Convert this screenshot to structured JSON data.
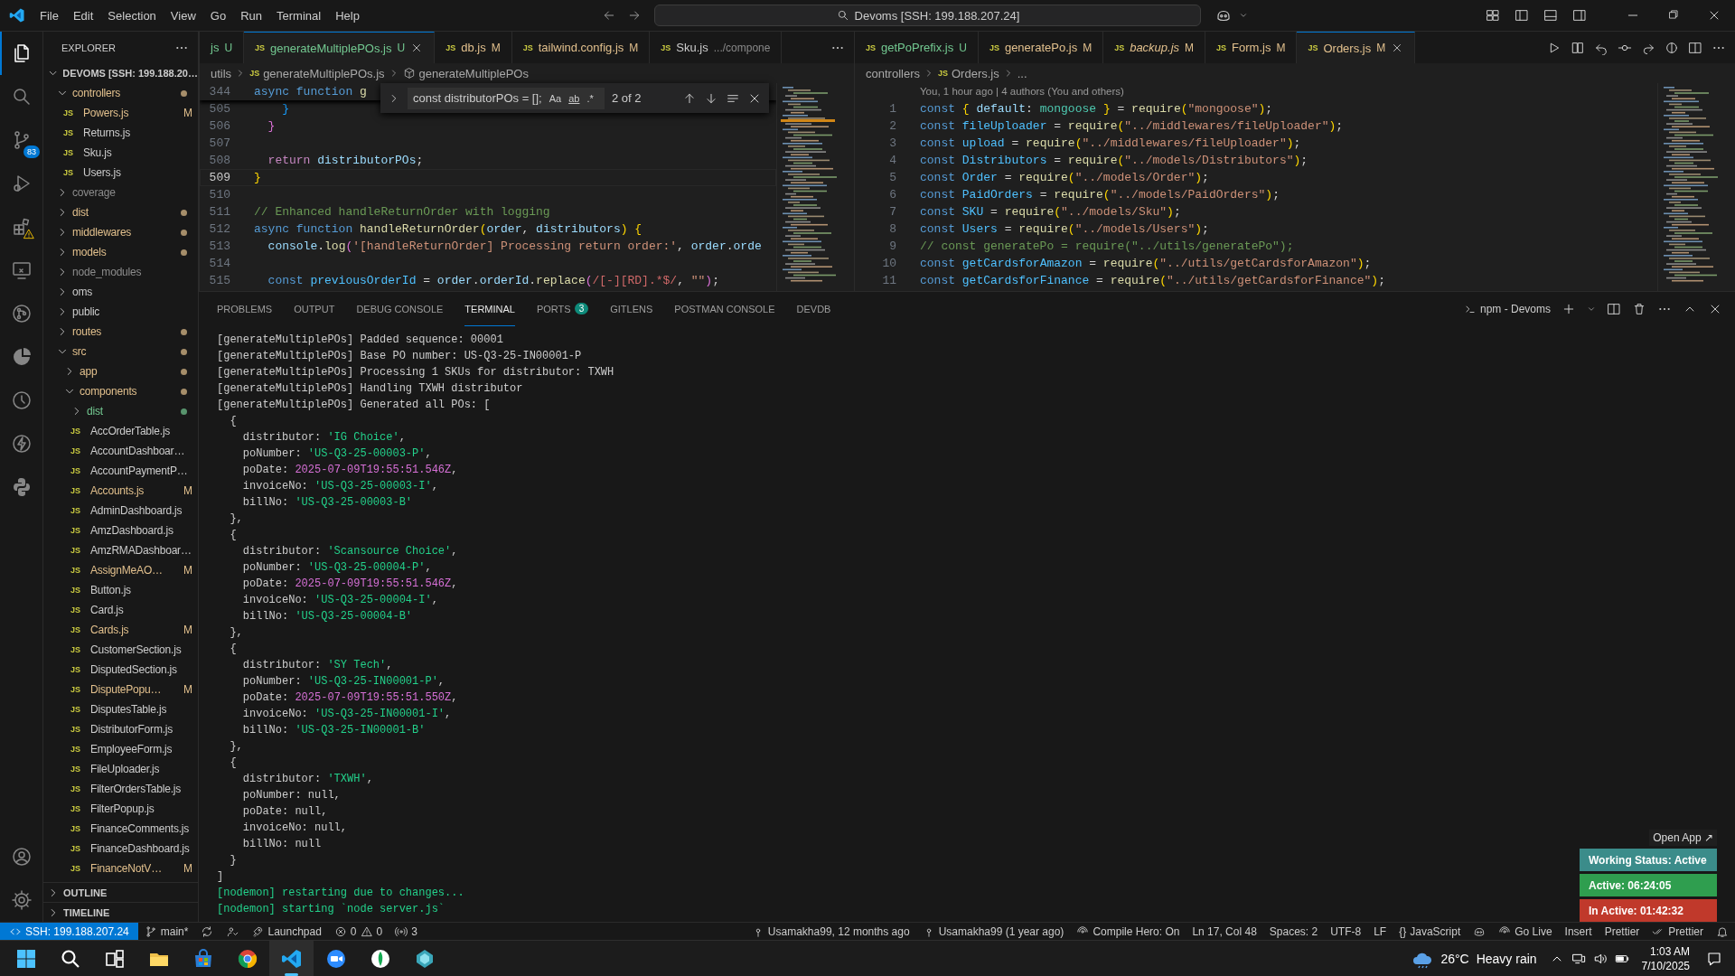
{
  "titlebar": {
    "menu": [
      "File",
      "Edit",
      "Selection",
      "View",
      "Go",
      "Run",
      "Terminal",
      "Help"
    ],
    "command_center": "Devoms [SSH: 199.188.207.24]"
  },
  "activity_bar": [
    {
      "kind": "files",
      "selected": true
    },
    {
      "kind": "search",
      "selected": false
    },
    {
      "kind": "source-control",
      "selected": false,
      "badge": "83"
    },
    {
      "kind": "debug",
      "selected": false
    },
    {
      "kind": "extensions",
      "selected": false,
      "warning": true
    },
    {
      "kind": "remote",
      "selected": false
    },
    {
      "kind": "git-graph",
      "selected": false
    },
    {
      "kind": "pie",
      "selected": false
    },
    {
      "kind": "history",
      "selected": false
    },
    {
      "kind": "bolt",
      "selected": false
    },
    {
      "kind": "python",
      "selected": false
    }
  ],
  "activity_bottom": [
    {
      "kind": "account"
    },
    {
      "kind": "settings"
    }
  ],
  "explorer": {
    "title": "EXPLORER",
    "root": "DEVOMS [SSH: 199.188.20…",
    "tree": [
      {
        "name": "controllers",
        "kind": "folder",
        "expanded": true,
        "color": "#e2c08d",
        "dot": true,
        "children": [
          {
            "name": "Powers.js",
            "kind": "file",
            "icon": "JS",
            "color": "#e2c08d",
            "dot": false,
            "badge": "M"
          },
          {
            "name": "Returns.js",
            "kind": "file",
            "icon": "JS",
            "color": "#cccccc",
            "dot": false
          },
          {
            "name": "Sku.js",
            "kind": "file",
            "icon": "JS",
            "color": "#cccccc",
            "dot": false
          },
          {
            "name": "Users.js",
            "kind": "file",
            "icon": "JS",
            "color": "#cccccc",
            "dot": false
          }
        ]
      },
      {
        "name": "coverage",
        "kind": "folder",
        "expanded": false,
        "color": "#8c8c8c",
        "dot": false
      },
      {
        "name": "dist",
        "kind": "folder",
        "expanded": false,
        "color": "#e2c08d",
        "dot": true
      },
      {
        "name": "middlewares",
        "kind": "folder",
        "expanded": false,
        "color": "#e2c08d",
        "dot": true
      },
      {
        "name": "models",
        "kind": "folder",
        "expanded": false,
        "color": "#e2c08d",
        "dot": true
      },
      {
        "name": "node_modules",
        "kind": "folder",
        "expanded": false,
        "color": "#8c8c8c",
        "dot": false
      },
      {
        "name": "oms",
        "kind": "folder",
        "expanded": false,
        "color": "#cccccc",
        "dot": false
      },
      {
        "name": "public",
        "kind": "folder",
        "expanded": false,
        "color": "#cccccc",
        "dot": false
      },
      {
        "name": "routes",
        "kind": "folder",
        "expanded": false,
        "color": "#e2c08d",
        "dot": true
      },
      {
        "name": "src",
        "kind": "folder",
        "expanded": true,
        "color": "#e2c08d",
        "dot": true,
        "children": [
          {
            "name": "app",
            "kind": "folder",
            "expanded": false,
            "color": "#e2c08d",
            "dot": true
          },
          {
            "name": "components",
            "kind": "folder",
            "expanded": true,
            "color": "#e2c08d",
            "dot": true,
            "children": [
              {
                "name": "dist",
                "kind": "folder",
                "expanded": false,
                "color": "#73c991",
                "dot": true
              },
              {
                "name": "AccOrderTable.js",
                "kind": "file",
                "icon": "JS",
                "color": "#cccccc",
                "dot": false
              },
              {
                "name": "AccountDashboar…",
                "kind": "file",
                "icon": "JS",
                "color": "#cccccc",
                "dot": false
              },
              {
                "name": "AccountPaymentP…",
                "kind": "file",
                "icon": "JS",
                "color": "#cccccc",
                "dot": false
              },
              {
                "name": "Accounts.js",
                "kind": "file",
                "icon": "JS",
                "color": "#e2c08d",
                "dot": false,
                "badge": "M"
              },
              {
                "name": "AdminDashboard.js",
                "kind": "file",
                "icon": "JS",
                "color": "#cccccc",
                "dot": false
              },
              {
                "name": "AmzDashboard.js",
                "kind": "file",
                "icon": "JS",
                "color": "#cccccc",
                "dot": false
              },
              {
                "name": "AmzRMADashboar…",
                "kind": "file",
                "icon": "JS",
                "color": "#cccccc",
                "dot": false
              },
              {
                "name": "AssignMeAO…",
                "kind": "file",
                "icon": "JS",
                "color": "#e2c08d",
                "dot": false,
                "badge": "M"
              },
              {
                "name": "Button.js",
                "kind": "file",
                "icon": "JS",
                "color": "#cccccc",
                "dot": false
              },
              {
                "name": "Card.js",
                "kind": "file",
                "icon": "JS",
                "color": "#cccccc",
                "dot": false
              },
              {
                "name": "Cards.js",
                "kind": "file",
                "icon": "JS",
                "color": "#e2c08d",
                "dot": false,
                "badge": "M"
              },
              {
                "name": "CustomerSection.js",
                "kind": "file",
                "icon": "JS",
                "color": "#cccccc",
                "dot": false
              },
              {
                "name": "DisputedSection.js",
                "kind": "file",
                "icon": "JS",
                "color": "#cccccc",
                "dot": false
              },
              {
                "name": "DisputePopu…",
                "kind": "file",
                "icon": "JS",
                "color": "#e2c08d",
                "dot": false,
                "badge": "M"
              },
              {
                "name": "DisputesTable.js",
                "kind": "file",
                "icon": "JS",
                "color": "#cccccc",
                "dot": false
              },
              {
                "name": "DistributorForm.js",
                "kind": "file",
                "icon": "JS",
                "color": "#cccccc",
                "dot": false
              },
              {
                "name": "EmployeeForm.js",
                "kind": "file",
                "icon": "JS",
                "color": "#cccccc",
                "dot": false
              },
              {
                "name": "FileUploader.js",
                "kind": "file",
                "icon": "JS",
                "color": "#cccccc",
                "dot": false
              },
              {
                "name": "FilterOrdersTable.js",
                "kind": "file",
                "icon": "JS",
                "color": "#cccccc",
                "dot": false
              },
              {
                "name": "FilterPopup.js",
                "kind": "file",
                "icon": "JS",
                "color": "#cccccc",
                "dot": false
              },
              {
                "name": "FinanceComments.js",
                "kind": "file",
                "icon": "JS",
                "color": "#cccccc",
                "dot": false
              },
              {
                "name": "FinanceDashboard.js",
                "kind": "file",
                "icon": "JS",
                "color": "#cccccc",
                "dot": false
              },
              {
                "name": "FinanceNotV…",
                "kind": "file",
                "icon": "JS",
                "color": "#e2c08d",
                "dot": false,
                "badge": "M"
              }
            ]
          }
        ]
      }
    ],
    "sections": [
      "OUTLINE",
      "TIMELINE"
    ]
  },
  "editors": [
    {
      "tabs": [
        {
          "label": "js",
          "status": "U",
          "selected": false,
          "preview": false
        },
        {
          "icon": "JS",
          "label": "generateMultiplePOs.js",
          "status": "U",
          "selected": true,
          "preview": false
        },
        {
          "icon": "JS",
          "label": "db.js",
          "status": "M",
          "selected": false,
          "preview": false
        },
        {
          "icon": "JS",
          "label": "tailwind.config.js",
          "status": "M",
          "selected": false,
          "preview": false
        },
        {
          "icon": "JS",
          "label": "Sku.js",
          "description": ".../compone",
          "selected": false,
          "preview": false
        }
      ],
      "breadcrumbs": [
        {
          "kind": "folder",
          "text": "utils"
        },
        {
          "kind": "file",
          "icon": "JS",
          "text": "generateMultiplePOs.js"
        },
        {
          "kind": "symbol",
          "text": "generateMultiplePOs"
        }
      ],
      "sticky_line": {
        "number": "344",
        "tokens": [
          {
            "text": "async function",
            "kind": "kw"
          },
          {
            "text": " g",
            "kind": "fn"
          }
        ]
      },
      "find": {
        "query": "const distributorPOs = [];",
        "options": [
          "Aa",
          "ab",
          ".*"
        ],
        "count": "2 of 2"
      },
      "lines": [
        {
          "number": "505",
          "current": false,
          "tokens": [
            {
              "text": "    }",
              "kind": "b3"
            }
          ]
        },
        {
          "number": "506",
          "current": false,
          "tokens": [
            {
              "text": "  }",
              "kind": "b2"
            }
          ]
        },
        {
          "number": "507",
          "current": false
        },
        {
          "number": "508",
          "current": false,
          "tokens": [
            {
              "text": "  return",
              "kind": "ctrl"
            },
            {
              "text": " distributorPOs",
              "kind": "var"
            },
            {
              "text": ";",
              "kind": "plain"
            }
          ]
        },
        {
          "number": "509",
          "current": true,
          "tokens": [
            {
              "text": "}",
              "kind": "b1"
            }
          ]
        },
        {
          "number": "510",
          "current": false
        },
        {
          "number": "511",
          "current": false,
          "tokens": [
            {
              "text": "// Enhanced handleReturnOrder with logging",
              "kind": "comment"
            }
          ]
        },
        {
          "number": "512",
          "current": false,
          "tokens": [
            {
              "text": "async function",
              "kind": "kw"
            },
            {
              "text": " handleReturnOrder",
              "kind": "fn"
            },
            {
              "text": "(",
              "kind": "b1"
            },
            {
              "text": "order",
              "kind": "var"
            },
            {
              "text": ", ",
              "kind": "plain"
            },
            {
              "text": "distributors",
              "kind": "var"
            },
            {
              "text": ")",
              "kind": "b1"
            },
            {
              "text": " {",
              "kind": "b1"
            }
          ]
        },
        {
          "number": "513",
          "current": false,
          "tokens": [
            {
              "text": "  console",
              "kind": "var"
            },
            {
              "text": ".",
              "kind": "plain"
            },
            {
              "text": "log",
              "kind": "fn"
            },
            {
              "text": "(",
              "kind": "b2"
            },
            {
              "text": "'[handleReturnOrder] Processing return order:'",
              "kind": "str"
            },
            {
              "text": ", ",
              "kind": "plain"
            },
            {
              "text": "order",
              "kind": "var"
            },
            {
              "text": ".",
              "kind": "plain"
            },
            {
              "text": "orde",
              "kind": "var"
            }
          ]
        },
        {
          "number": "514",
          "current": false
        },
        {
          "number": "515",
          "current": false,
          "tokens": [
            {
              "text": "  const",
              "kind": "kw"
            },
            {
              "text": " previousOrderId",
              "kind": "const"
            },
            {
              "text": " = ",
              "kind": "plain"
            },
            {
              "text": "order",
              "kind": "var"
            },
            {
              "text": ".",
              "kind": "plain"
            },
            {
              "text": "orderId",
              "kind": "var"
            },
            {
              "text": ".",
              "kind": "plain"
            },
            {
              "text": "replace",
              "kind": "fn"
            },
            {
              "text": "(",
              "kind": "b2"
            },
            {
              "text": "/[-][RD].*$/",
              "kind": "regex"
            },
            {
              "text": ", ",
              "kind": "plain"
            },
            {
              "text": "\"\"",
              "kind": "str"
            },
            {
              "text": ")",
              "kind": "b2"
            },
            {
              "text": ";",
              "kind": "plain"
            }
          ]
        }
      ]
    },
    {
      "tabs": [
        {
          "icon": "JS",
          "label": "getPoPrefix.js",
          "status": "U",
          "selected": false,
          "preview": false
        },
        {
          "icon": "JS",
          "label": "generatePo.js",
          "status": "M",
          "selected": false,
          "preview": false
        },
        {
          "icon": "JS",
          "label": "backup.js",
          "status": "M",
          "selected": false,
          "preview": true
        },
        {
          "icon": "JS",
          "label": "Form.js",
          "status": "M",
          "selected": false,
          "preview": false
        },
        {
          "icon": "JS",
          "label": "Orders.js",
          "status": "M",
          "selected": true,
          "preview": false
        }
      ],
      "breadcrumbs": [
        {
          "kind": "folder",
          "text": "controllers"
        },
        {
          "kind": "file",
          "icon": "JS",
          "text": "Orders.js"
        },
        {
          "kind": "more",
          "text": "..."
        }
      ],
      "blame": "You, 1 hour ago | 4 authors (You and others)",
      "lines": [
        {
          "number": "1",
          "current": false,
          "tokens": [
            {
              "text": "const",
              "kind": "kw"
            },
            {
              "text": " {",
              "kind": "b1"
            },
            {
              "text": " default",
              "kind": "var"
            },
            {
              "text": ": ",
              "kind": "plain"
            },
            {
              "text": "mongoose",
              "kind": "type"
            },
            {
              "text": " }",
              "kind": "b1"
            },
            {
              "text": " = ",
              "kind": "plain"
            },
            {
              "text": "require",
              "kind": "fn"
            },
            {
              "text": "(",
              "kind": "b1"
            },
            {
              "text": "\"mongoose\"",
              "kind": "str"
            },
            {
              "text": ")",
              "kind": "b1"
            },
            {
              "text": ";",
              "kind": "plain"
            }
          ]
        },
        {
          "number": "2",
          "current": false,
          "tokens": [
            {
              "text": "const",
              "kind": "kw"
            },
            {
              "text": " fileUploader",
              "kind": "const"
            },
            {
              "text": " = ",
              "kind": "plain"
            },
            {
              "text": "require",
              "kind": "fn"
            },
            {
              "text": "(",
              "kind": "b1"
            },
            {
              "text": "\"../middlewares/fileUploader\"",
              "kind": "str"
            },
            {
              "text": ")",
              "kind": "b1"
            },
            {
              "text": ";",
              "kind": "plain"
            }
          ]
        },
        {
          "number": "3",
          "current": false,
          "tokens": [
            {
              "text": "const",
              "kind": "kw"
            },
            {
              "text": " upload",
              "kind": "const"
            },
            {
              "text": " = ",
              "kind": "plain"
            },
            {
              "text": "require",
              "kind": "fn"
            },
            {
              "text": "(",
              "kind": "b1"
            },
            {
              "text": "\"../middlewares/fileUploader\"",
              "kind": "str"
            },
            {
              "text": ")",
              "kind": "b1"
            },
            {
              "text": ";",
              "kind": "plain"
            }
          ]
        },
        {
          "number": "4",
          "current": false,
          "tokens": [
            {
              "text": "const",
              "kind": "kw"
            },
            {
              "text": " Distributors",
              "kind": "const"
            },
            {
              "text": " = ",
              "kind": "plain"
            },
            {
              "text": "require",
              "kind": "fn"
            },
            {
              "text": "(",
              "kind": "b1"
            },
            {
              "text": "\"../models/Distributors\"",
              "kind": "str"
            },
            {
              "text": ")",
              "kind": "b1"
            },
            {
              "text": ";",
              "kind": "plain"
            }
          ]
        },
        {
          "number": "5",
          "current": false,
          "tokens": [
            {
              "text": "const",
              "kind": "kw"
            },
            {
              "text": " Order",
              "kind": "const"
            },
            {
              "text": " = ",
              "kind": "plain"
            },
            {
              "text": "require",
              "kind": "fn"
            },
            {
              "text": "(",
              "kind": "b1"
            },
            {
              "text": "\"../models/Order\"",
              "kind": "str"
            },
            {
              "text": ")",
              "kind": "b1"
            },
            {
              "text": ";",
              "kind": "plain"
            }
          ]
        },
        {
          "number": "6",
          "current": false,
          "tokens": [
            {
              "text": "const",
              "kind": "kw"
            },
            {
              "text": " PaidOrders",
              "kind": "const"
            },
            {
              "text": " = ",
              "kind": "plain"
            },
            {
              "text": "require",
              "kind": "fn"
            },
            {
              "text": "(",
              "kind": "b1"
            },
            {
              "text": "\"../models/PaidOrders\"",
              "kind": "str"
            },
            {
              "text": ")",
              "kind": "b1"
            },
            {
              "text": ";",
              "kind": "plain"
            }
          ]
        },
        {
          "number": "7",
          "current": false,
          "tokens": [
            {
              "text": "const",
              "kind": "kw"
            },
            {
              "text": " SKU",
              "kind": "const"
            },
            {
              "text": " = ",
              "kind": "plain"
            },
            {
              "text": "require",
              "kind": "fn"
            },
            {
              "text": "(",
              "kind": "b1"
            },
            {
              "text": "\"../models/Sku\"",
              "kind": "str"
            },
            {
              "text": ")",
              "kind": "b1"
            },
            {
              "text": ";",
              "kind": "plain"
            }
          ]
        },
        {
          "number": "8",
          "current": false,
          "tokens": [
            {
              "text": "const",
              "kind": "kw"
            },
            {
              "text": " Users",
              "kind": "const"
            },
            {
              "text": " = ",
              "kind": "plain"
            },
            {
              "text": "require",
              "kind": "fn"
            },
            {
              "text": "(",
              "kind": "b1"
            },
            {
              "text": "\"../models/Users\"",
              "kind": "str"
            },
            {
              "text": ")",
              "kind": "b1"
            },
            {
              "text": ";",
              "kind": "plain"
            }
          ]
        },
        {
          "number": "9",
          "current": false,
          "tokens": [
            {
              "text": "// const generatePo = require(\"../utils/generatePo\");",
              "kind": "comment"
            }
          ]
        },
        {
          "number": "10",
          "current": false,
          "tokens": [
            {
              "text": "const",
              "kind": "kw"
            },
            {
              "text": " getCardsforAmazon",
              "kind": "const"
            },
            {
              "text": " = ",
              "kind": "plain"
            },
            {
              "text": "require",
              "kind": "fn"
            },
            {
              "text": "(",
              "kind": "b1"
            },
            {
              "text": "\"../utils/getCardsforAmazon\"",
              "kind": "str"
            },
            {
              "text": ")",
              "kind": "b1"
            },
            {
              "text": ";",
              "kind": "plain"
            }
          ]
        },
        {
          "number": "11",
          "current": false,
          "tokens": [
            {
              "text": "const",
              "kind": "kw"
            },
            {
              "text": " getCardsforFinance",
              "kind": "const"
            },
            {
              "text": " = ",
              "kind": "plain"
            },
            {
              "text": "require",
              "kind": "fn"
            },
            {
              "text": "(",
              "kind": "b1"
            },
            {
              "text": "\"../utils/getCardsforFinance\"",
              "kind": "str"
            },
            {
              "text": ")",
              "kind": "b1"
            },
            {
              "text": ";",
              "kind": "plain"
            }
          ]
        }
      ]
    }
  ],
  "panel": {
    "tabs": [
      {
        "label": "PROBLEMS",
        "selected": false
      },
      {
        "label": "OUTPUT",
        "selected": false
      },
      {
        "label": "DEBUG CONSOLE",
        "selected": false
      },
      {
        "label": "TERMINAL",
        "selected": true
      },
      {
        "label": "PORTS",
        "selected": false,
        "badge": "3"
      },
      {
        "label": "GITLENS",
        "selected": false
      },
      {
        "label": "POSTMAN CONSOLE",
        "selected": false
      },
      {
        "label": "DEVDB",
        "selected": false
      }
    ],
    "terminal_name": "npm - Devoms",
    "terminal": [
      [
        {
          "text": "[generateMultiplePOs] Padded sequence: 00001",
          "kind": "plain"
        }
      ],
      [
        {
          "text": "[generateMultiplePOs] Base PO number: US-Q3-25-IN00001-P",
          "kind": "plain"
        }
      ],
      [
        {
          "text": "[generateMultiplePOs] Processing 1 SKUs for distributor: TXWH",
          "kind": "plain"
        }
      ],
      [
        {
          "text": "[generateMultiplePOs] Handling TXWH distributor",
          "kind": "plain"
        }
      ],
      [
        {
          "text": "[generateMultiplePOs] Generated all POs: [",
          "kind": "plain"
        }
      ],
      [
        {
          "text": "  {",
          "kind": "plain"
        }
      ],
      [
        {
          "text": "    distributor: ",
          "kind": "plain"
        },
        {
          "text": "'IG Choice'",
          "kind": "string"
        },
        {
          "text": ",",
          "kind": "plain"
        }
      ],
      [
        {
          "text": "    poNumber: ",
          "kind": "plain"
        },
        {
          "text": "'US-Q3-25-00003-P'",
          "kind": "string"
        },
        {
          "text": ",",
          "kind": "plain"
        }
      ],
      [
        {
          "text": "    poDate: ",
          "kind": "plain"
        },
        {
          "text": "2025-07-09T19:55:51.546Z",
          "kind": "date"
        },
        {
          "text": ",",
          "kind": "plain"
        }
      ],
      [
        {
          "text": "    invoiceNo: ",
          "kind": "plain"
        },
        {
          "text": "'US-Q3-25-00003-I'",
          "kind": "string"
        },
        {
          "text": ",",
          "kind": "plain"
        }
      ],
      [
        {
          "text": "    billNo: ",
          "kind": "plain"
        },
        {
          "text": "'US-Q3-25-00003-B'",
          "kind": "string"
        }
      ],
      [
        {
          "text": "  },",
          "kind": "plain"
        }
      ],
      [
        {
          "text": "  {",
          "kind": "plain"
        }
      ],
      [
        {
          "text": "    distributor: ",
          "kind": "plain"
        },
        {
          "text": "'Scansource Choice'",
          "kind": "string"
        },
        {
          "text": ",",
          "kind": "plain"
        }
      ],
      [
        {
          "text": "    poNumber: ",
          "kind": "plain"
        },
        {
          "text": "'US-Q3-25-00004-P'",
          "kind": "string"
        },
        {
          "text": ",",
          "kind": "plain"
        }
      ],
      [
        {
          "text": "    poDate: ",
          "kind": "plain"
        },
        {
          "text": "2025-07-09T19:55:51.546Z",
          "kind": "date"
        },
        {
          "text": ",",
          "kind": "plain"
        }
      ],
      [
        {
          "text": "    invoiceNo: ",
          "kind": "plain"
        },
        {
          "text": "'US-Q3-25-00004-I'",
          "kind": "string"
        },
        {
          "text": ",",
          "kind": "plain"
        }
      ],
      [
        {
          "text": "    billNo: ",
          "kind": "plain"
        },
        {
          "text": "'US-Q3-25-00004-B'",
          "kind": "string"
        }
      ],
      [
        {
          "text": "  },",
          "kind": "plain"
        }
      ],
      [
        {
          "text": "  {",
          "kind": "plain"
        }
      ],
      [
        {
          "text": "    distributor: ",
          "kind": "plain"
        },
        {
          "text": "'SY Tech'",
          "kind": "string"
        },
        {
          "text": ",",
          "kind": "plain"
        }
      ],
      [
        {
          "text": "    poNumber: ",
          "kind": "plain"
        },
        {
          "text": "'US-Q3-25-IN00001-P'",
          "kind": "string"
        },
        {
          "text": ",",
          "kind": "plain"
        }
      ],
      [
        {
          "text": "    poDate: ",
          "kind": "plain"
        },
        {
          "text": "2025-07-09T19:55:51.550Z",
          "kind": "date"
        },
        {
          "text": ",",
          "kind": "plain"
        }
      ],
      [
        {
          "text": "    invoiceNo: ",
          "kind": "plain"
        },
        {
          "text": "'US-Q3-25-IN00001-I'",
          "kind": "string"
        },
        {
          "text": ",",
          "kind": "plain"
        }
      ],
      [
        {
          "text": "    billNo: ",
          "kind": "plain"
        },
        {
          "text": "'US-Q3-25-IN00001-B'",
          "kind": "string"
        }
      ],
      [
        {
          "text": "  },",
          "kind": "plain"
        }
      ],
      [
        {
          "text": "  {",
          "kind": "plain"
        }
      ],
      [
        {
          "text": "    distributor: ",
          "kind": "plain"
        },
        {
          "text": "'TXWH'",
          "kind": "string"
        },
        {
          "text": ",",
          "kind": "plain"
        }
      ],
      [
        {
          "text": "    poNumber: null,",
          "kind": "plain"
        }
      ],
      [
        {
          "text": "    poDate: null,",
          "kind": "plain"
        }
      ],
      [
        {
          "text": "    invoiceNo: null,",
          "kind": "plain"
        }
      ],
      [
        {
          "text": "    billNo: null",
          "kind": "plain"
        }
      ],
      [
        {
          "text": "  }",
          "kind": "plain"
        }
      ],
      [
        {
          "text": "]",
          "kind": "plain"
        }
      ],
      [
        {
          "text": "[nodemon] restarting due to changes...",
          "kind": "log"
        }
      ],
      [
        {
          "text": "[nodemon] starting `node server.js`",
          "kind": "log"
        }
      ]
    ]
  },
  "tracker": {
    "link": "Open App ↗",
    "items": [
      {
        "text": "Working Status: Active",
        "color": "#3b8c8a"
      },
      {
        "text": "Active: 06:24:05",
        "color": "#2f9e4f"
      },
      {
        "text": "In Active: 01:42:32",
        "color": "#c0392b"
      }
    ]
  },
  "status_bar": {
    "left": [
      {
        "kind": "remote",
        "text": "SSH: 199.188.207.24"
      },
      {
        "kind": "branch",
        "text": "main*"
      },
      {
        "kind": "sync"
      },
      {
        "kind": "account"
      },
      {
        "kind": "launchpad",
        "text": "Launchpad"
      },
      {
        "kind": "problems",
        "errors": "0",
        "warnings": "0"
      },
      {
        "kind": "ports",
        "text": "3"
      }
    ],
    "right": [
      {
        "kind": "blame",
        "text": "Usamakha99, 12 months ago"
      },
      {
        "kind": "blame",
        "text": "Usamakha99 (1 year ago)"
      },
      {
        "kind": "broadcast",
        "text": "Compile Hero: On"
      },
      {
        "kind": "text",
        "text": "Ln 17, Col 48"
      },
      {
        "kind": "text",
        "text": "Spaces: 2"
      },
      {
        "kind": "text",
        "text": "UTF-8"
      },
      {
        "kind": "text",
        "text": "LF"
      },
      {
        "kind": "language",
        "icon": "{}",
        "text": "JavaScript"
      },
      {
        "kind": "copilot"
      },
      {
        "kind": "golive",
        "text": "Go Live"
      },
      {
        "kind": "text",
        "text": "Insert"
      },
      {
        "kind": "text",
        "text": "Prettier"
      },
      {
        "kind": "prettier",
        "text": "Prettier"
      },
      {
        "kind": "bell"
      }
    ]
  },
  "taskbar": {
    "apps": [
      {
        "kind": "start",
        "active": false
      },
      {
        "kind": "search",
        "active": false
      },
      {
        "kind": "taskview",
        "active": false
      },
      {
        "kind": "folder",
        "active": false
      },
      {
        "kind": "store",
        "active": false
      },
      {
        "kind": "browser",
        "active": false
      },
      {
        "kind": "code",
        "active": true
      },
      {
        "kind": "video",
        "active": false
      },
      {
        "kind": "leaf",
        "active": false
      },
      {
        "kind": "diamond",
        "active": false
      }
    ],
    "weather": {
      "temp": "26°C",
      "text": "Heavy rain"
    },
    "time": "1:03 AM",
    "date": "7/10/2025"
  }
}
